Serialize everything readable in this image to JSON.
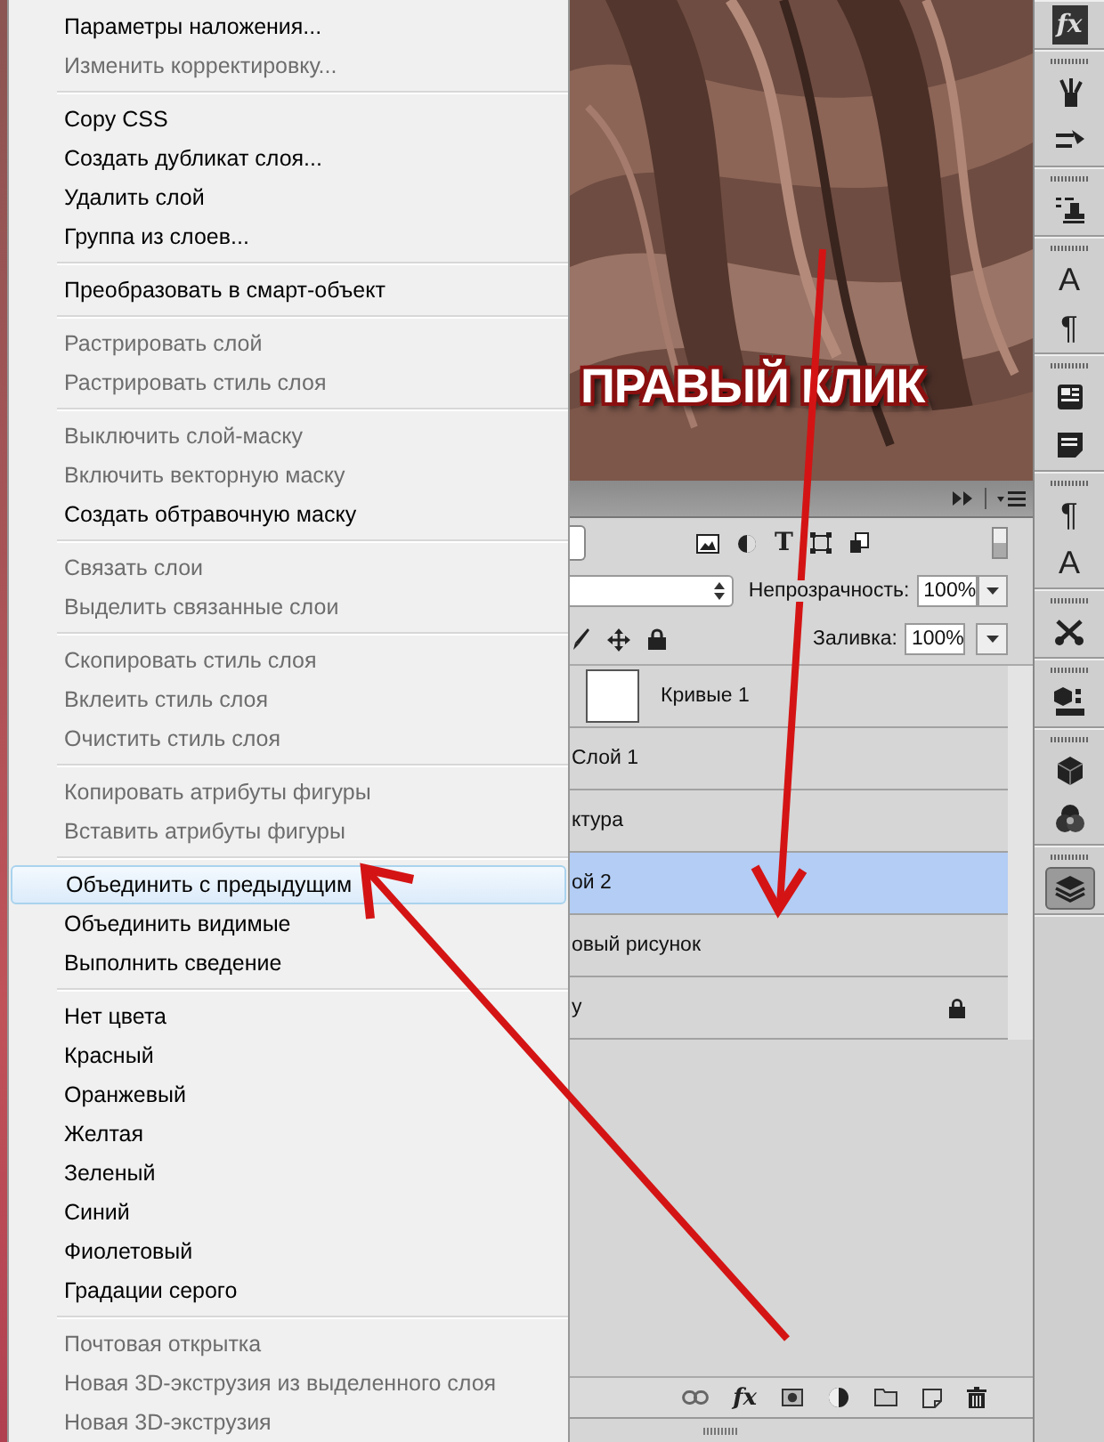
{
  "menu": {
    "groups": [
      [
        {
          "label": "Параметры наложения...",
          "disabled": false,
          "selected": false
        },
        {
          "label": "Изменить корректировку...",
          "disabled": true,
          "selected": false
        }
      ],
      [
        {
          "label": "Copy CSS",
          "disabled": false,
          "selected": false
        },
        {
          "label": "Создать дубликат слоя...",
          "disabled": false,
          "selected": false
        },
        {
          "label": "Удалить слой",
          "disabled": false,
          "selected": false
        },
        {
          "label": "Группа из слоев...",
          "disabled": false,
          "selected": false
        }
      ],
      [
        {
          "label": "Преобразовать в смарт-объект",
          "disabled": false,
          "selected": false
        }
      ],
      [
        {
          "label": "Растрировать слой",
          "disabled": true,
          "selected": false
        },
        {
          "label": "Растрировать стиль слоя",
          "disabled": true,
          "selected": false
        }
      ],
      [
        {
          "label": "Выключить слой-маску",
          "disabled": true,
          "selected": false
        },
        {
          "label": "Включить векторную маску",
          "disabled": true,
          "selected": false
        },
        {
          "label": "Создать обтравочную маску",
          "disabled": false,
          "selected": false
        }
      ],
      [
        {
          "label": "Связать слои",
          "disabled": true,
          "selected": false
        },
        {
          "label": "Выделить связанные слои",
          "disabled": true,
          "selected": false
        }
      ],
      [
        {
          "label": "Скопировать стиль слоя",
          "disabled": true,
          "selected": false
        },
        {
          "label": "Вклеить стиль слоя",
          "disabled": true,
          "selected": false
        },
        {
          "label": "Очистить стиль слоя",
          "disabled": true,
          "selected": false
        }
      ],
      [
        {
          "label": "Копировать атрибуты фигуры",
          "disabled": true,
          "selected": false
        },
        {
          "label": "Вставить атрибуты фигуры",
          "disabled": true,
          "selected": false
        }
      ],
      [
        {
          "label": "Объединить с предыдущим",
          "disabled": false,
          "selected": true
        },
        {
          "label": "Объединить видимые",
          "disabled": false,
          "selected": false
        },
        {
          "label": "Выполнить сведение",
          "disabled": false,
          "selected": false
        }
      ],
      [
        {
          "label": "Нет цвета",
          "disabled": false,
          "selected": false
        },
        {
          "label": "Красный",
          "disabled": false,
          "selected": false
        },
        {
          "label": "Оранжевый",
          "disabled": false,
          "selected": false
        },
        {
          "label": "Желтая",
          "disabled": false,
          "selected": false
        },
        {
          "label": "Зеленый",
          "disabled": false,
          "selected": false
        },
        {
          "label": "Синий",
          "disabled": false,
          "selected": false
        },
        {
          "label": "Фиолетовый",
          "disabled": false,
          "selected": false
        },
        {
          "label": "Градации серого",
          "disabled": false,
          "selected": false
        }
      ],
      [
        {
          "label": "Почтовая открытка",
          "disabled": true,
          "selected": false
        },
        {
          "label": "Новая 3D-экструзия из выделенного слоя",
          "disabled": true,
          "selected": false
        },
        {
          "label": "Новая 3D-экструзия",
          "disabled": true,
          "selected": false
        }
      ]
    ]
  },
  "annotation": "ПРАВЫЙ КЛИК",
  "layers_panel": {
    "type_filter_glyph": "T",
    "opacity_label": "Непрозрачность:",
    "opacity": "100%",
    "fill_label": "Заливка:",
    "fill": "100%",
    "layers": [
      {
        "name": "Кривые 1",
        "thumbnail": true,
        "selected": false,
        "locked": false
      },
      {
        "name": "Слой 1",
        "thumbnail": false,
        "selected": false,
        "locked": false
      },
      {
        "name": "ктура",
        "thumbnail": false,
        "selected": false,
        "locked": false
      },
      {
        "name": "ой 2",
        "thumbnail": false,
        "selected": true,
        "locked": false
      },
      {
        "name": "овый рисунок",
        "thumbnail": false,
        "selected": false,
        "locked": false
      },
      {
        "name": "у",
        "thumbnail": false,
        "selected": false,
        "locked": true
      }
    ],
    "effects_glyph": "fx"
  },
  "toolbar": [
    [
      {
        "glyph": "fx",
        "selected": false
      }
    ],
    [
      {
        "selected": false
      },
      {
        "selected": false
      }
    ],
    [
      {
        "selected": false
      }
    ],
    [
      {
        "glyph": "A",
        "selected": false
      },
      {
        "glyph": "¶",
        "selected": false
      }
    ],
    [
      {
        "selected": false
      },
      {
        "selected": false
      }
    ],
    [
      {
        "glyph": "¶",
        "selected": false
      },
      {
        "glyph": "A",
        "selected": false
      }
    ],
    [
      {
        "selected": false
      }
    ],
    [
      {
        "selected": false
      }
    ],
    [
      {
        "selected": false
      },
      {
        "selected": false
      }
    ],
    [
      {
        "selected": true
      }
    ]
  ]
}
